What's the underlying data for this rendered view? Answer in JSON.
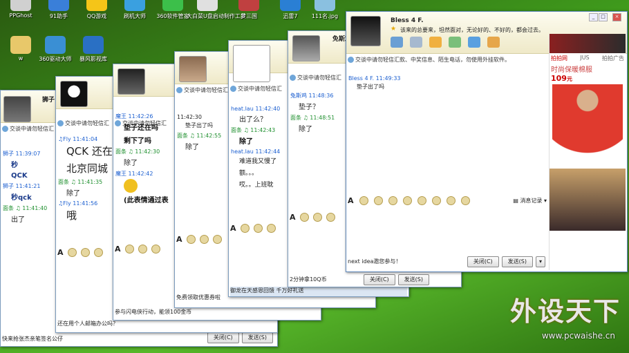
{
  "desktop": {
    "icons_row1": [
      "PPGhost",
      "91助手",
      "QQ游戏",
      "刷机大师",
      "360软件管家",
      "大白菜U盘启动制作工具",
      "梦三国",
      "迅雷7",
      "111名.jpg"
    ],
    "icons_row2": [
      "w",
      "360驱动大师",
      "暴风影视库"
    ],
    "colors": {
      "desktop": "#3f9a1c"
    }
  },
  "windows": [
    {
      "id": "w1",
      "title_tab": "狮子",
      "notice": "交谈中请勿轻信汇",
      "messages": [
        {
          "sender": "狮子",
          "time": "11:39:07",
          "color": "blue",
          "lines": [
            "秒",
            "QCK"
          ]
        },
        {
          "sender": "狮子",
          "time": "11:41:21",
          "color": "blue",
          "lines": [
            "秒qck"
          ]
        },
        {
          "sender": "面条 ♫",
          "time": "11:41:40",
          "color": "green",
          "lines": [
            "出了"
          ]
        }
      ],
      "footer": "快来抢张杰亲笔签名公仔",
      "close": "关闭(C)",
      "send": "发送(S)"
    },
    {
      "id": "w2",
      "notice": "交谈中请勿轻信汇",
      "messages": [
        {
          "sender": "♫Fly",
          "time": "11:41:04",
          "color": "blue",
          "lines": [
            "QCK  还在",
            "北京同城"
          ]
        },
        {
          "sender": "面条 ♫",
          "time": "11:41:35",
          "color": "green",
          "lines": [
            "除了"
          ]
        },
        {
          "sender": "♫Fly",
          "time": "11:41:56",
          "color": "blue",
          "lines": [
            "哦"
          ]
        }
      ],
      "footer": "还在用个人邮箱办公吗？",
      "close": "关闭(C)",
      "send": "发送(S)"
    },
    {
      "id": "w3",
      "notice": "交谈中请勿轻信汇",
      "messages": [
        {
          "sender": "魔王",
          "time": "11:42:26",
          "color": "blue",
          "lines": [
            "垫子还在吗",
            "剩下了吗"
          ]
        },
        {
          "sender": "面条 ♫",
          "time": "11:42:30",
          "color": "green",
          "lines": [
            "除了"
          ]
        },
        {
          "sender": "魔王",
          "time": "11:42:42",
          "color": "blue",
          "lines": [
            "(此表情通过表"
          ]
        }
      ],
      "footer": "参与闪电侠行动，能领100金币",
      "close": "关闭(C)",
      "send": "发送(S)"
    },
    {
      "id": "w4",
      "notice": "交谈中请勿轻信汇",
      "messages": [
        {
          "sender": "",
          "time": "11:42:30",
          "color": "blue",
          "lines": [
            "垫子出了吗"
          ]
        },
        {
          "sender": "面条 ♫",
          "time": "11:42:55",
          "color": "green",
          "lines": [
            "除了"
          ]
        }
      ],
      "footer": "免费领取优惠券啦",
      "close": "关闭(C)",
      "send": "发送(S)"
    },
    {
      "id": "w5",
      "notice": "交谈中请勿轻信汇",
      "messages": [
        {
          "sender": "heat.lau",
          "time": "11:42:40",
          "color": "blue",
          "lines": [
            "出了么？"
          ]
        },
        {
          "sender": "面条 ♫",
          "time": "11:42:43",
          "color": "green",
          "lines": [
            "除了"
          ]
        },
        {
          "sender": "heat.lau",
          "time": "11:42:44",
          "color": "blue",
          "lines": [
            "难道我又慢了",
            "额。。。",
            "哎。。上班耽"
          ]
        }
      ],
      "footer": "御龙在天感恩回馈 千万好礼送",
      "close": "关闭(C)",
      "send": "发送(S)"
    },
    {
      "id": "w6",
      "title_tab": "免斯鸡",
      "notice": "交谈中请勿轻信汇",
      "messages": [
        {
          "sender": "兔斯鸡",
          "time": "11:48:36",
          "color": "blue",
          "lines": [
            "垫子？"
          ]
        },
        {
          "sender": "面条 ♫",
          "time": "11:48:51",
          "color": "green",
          "lines": [
            "除了"
          ]
        }
      ],
      "footer": "2分钟拿10Q币",
      "close": "关闭(C)",
      "send": "发送(S)"
    },
    {
      "id": "w7",
      "title": "Bless 4 F.",
      "signature": "该来的总要来，坦然面对，无论好的、不好的，都会过去。",
      "notice": "交谈中请勿轻信汇款、中奖信息、陌生电话，勿使用外挂软件。",
      "messages": [
        {
          "sender": "Bless 4 F.",
          "time": "11:49:33",
          "color": "blue",
          "lines": [
            "垫子出了吗"
          ]
        }
      ],
      "toolbar_record": "消息记录",
      "footer": "next idea邀您参与！",
      "close": "关闭(C)",
      "send": "发送(S)"
    }
  ],
  "ad": {
    "brand": "拍拍网",
    "brand2": "JUS",
    "tag": "拍拍广告",
    "product": "时尚保暖棉服",
    "price": "109",
    "unit": "元"
  },
  "watermark": {
    "text": "外设天下",
    "url": "www.pcwaishe.cn"
  }
}
